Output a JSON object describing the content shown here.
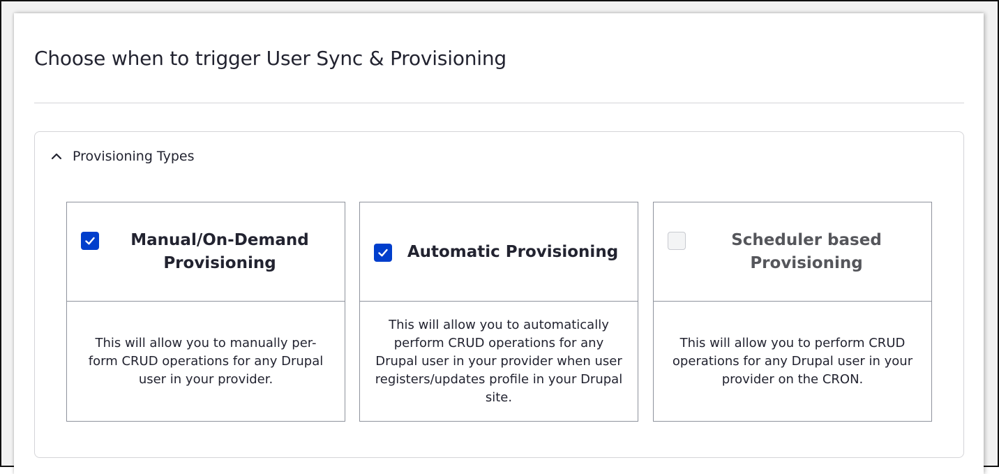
{
  "page": {
    "title": "Choose when to trigger User Sync & Provisioning"
  },
  "section": {
    "label": "Provisioning Types",
    "expanded": true,
    "icon": "chevron-up-icon"
  },
  "cards": [
    {
      "title": "Manual/On-Demand Provisioning",
      "checked": true,
      "disabled": false,
      "description": "This will allow you to manually per-form CRUD operations for any Drupal user in your provider."
    },
    {
      "title": "Automatic Provisioning",
      "checked": true,
      "disabled": false,
      "description": "This will allow you to automatically perform CRUD operations for any Drupal user in your provider when user registers/updates profile in your Drupal site."
    },
    {
      "title": "Scheduler based Provisioning",
      "checked": false,
      "disabled": true,
      "description": "This will allow you to perform CRUD operations for any Drupal user in your provider on the CRON."
    }
  ],
  "colors": {
    "checkbox_checked": "#003ecc",
    "text": "#222330",
    "border": "#8e929c"
  }
}
